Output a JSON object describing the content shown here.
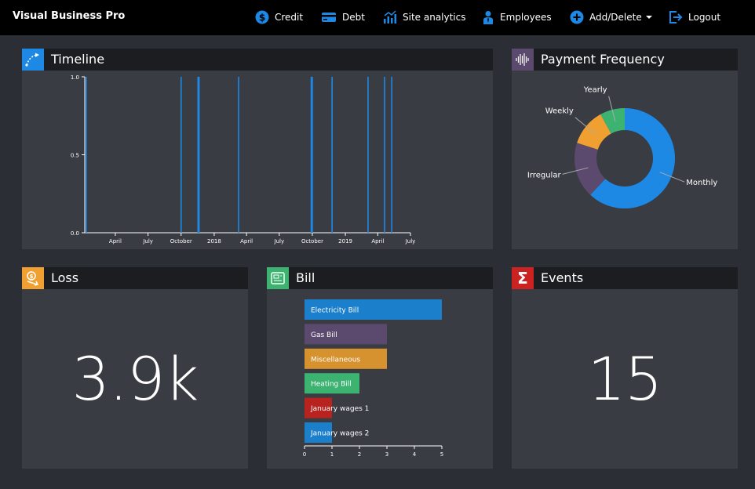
{
  "navbar": {
    "brand": "Visual Business Pro",
    "items": [
      {
        "label": "Credit",
        "icon": "dollar-circle-icon"
      },
      {
        "label": "Debt",
        "icon": "credit-card-icon"
      },
      {
        "label": "Site analytics",
        "icon": "analytics-icon"
      },
      {
        "label": "Employees",
        "icon": "employee-icon"
      },
      {
        "label": "Add/Delete",
        "icon": "plus-circle-icon"
      },
      {
        "label": "Logout",
        "icon": "logout-icon"
      }
    ]
  },
  "timeline": {
    "title": "Timeline",
    "icon": "timeline-icon",
    "icon_color": "#1e88e5"
  },
  "payment_frequency": {
    "title": "Payment Frequency",
    "icon": "soundwave-icon",
    "icon_color": "#5c4a6e"
  },
  "loss": {
    "title": "Loss",
    "icon": "money-down-icon",
    "icon_color": "#f0a030",
    "value": "3.9k"
  },
  "bill": {
    "title": "Bill",
    "icon": "bill-icon",
    "icon_color": "#3cb371"
  },
  "events": {
    "title": "Events",
    "icon": "sigma-icon",
    "icon_color": "#cc2222",
    "value": "15"
  },
  "chart_data": [
    {
      "type": "line",
      "title": "Timeline",
      "y_ticks": [
        "1.0",
        "0.5",
        "0.0"
      ],
      "y_tick_values": [
        1.0,
        0.5,
        0.0
      ],
      "ylim": [
        0,
        1
      ],
      "x_ticks": [
        "April",
        "July",
        "October",
        "2018",
        "April",
        "July",
        "October",
        "2019",
        "April",
        "July"
      ],
      "x_tick_values": [
        "2017-04-01",
        "2017-07-01",
        "2017-10-01",
        "2018-01-01",
        "2018-04-01",
        "2018-07-01",
        "2018-10-01",
        "2019-01-01",
        "2019-04-01",
        "2019-07-01"
      ],
      "xlim": [
        "2017-01-06",
        "2019-07-01"
      ],
      "events": [
        "2017-01-10",
        "2017-10-01",
        "2017-11-17",
        "2017-11-20",
        "2018-03-10",
        "2018-09-28",
        "2018-10-01",
        "2018-11-25",
        "2019-03-05",
        "2019-04-20",
        "2019-05-10"
      ],
      "grid": false,
      "color": "#1e88e5"
    },
    {
      "type": "pie",
      "title": "Payment Frequency",
      "categories": [
        "Monthly",
        "Irregular",
        "Weekly",
        "Yearly"
      ],
      "values": [
        62,
        18,
        12,
        8
      ],
      "colors": [
        "#1e88e5",
        "#5c4a6e",
        "#f0a030",
        "#3cb371"
      ],
      "donut": true
    },
    {
      "type": "bar",
      "title": "Bill",
      "orientation": "horizontal",
      "categories": [
        "Electricity Bill",
        "Gas Bill",
        "Miscellaneous",
        "Heating Bill",
        "January wages 1",
        "January wages 2"
      ],
      "values": [
        5,
        3,
        3,
        2,
        1,
        1
      ],
      "colors": [
        "#1b7fcc",
        "#5c4a6e",
        "#d6922e",
        "#3cb371",
        "#b8231f",
        "#1b7fcc"
      ],
      "x_ticks": [
        "0",
        "1",
        "2",
        "3",
        "4",
        "5"
      ],
      "xlim": [
        0,
        5
      ]
    }
  ]
}
